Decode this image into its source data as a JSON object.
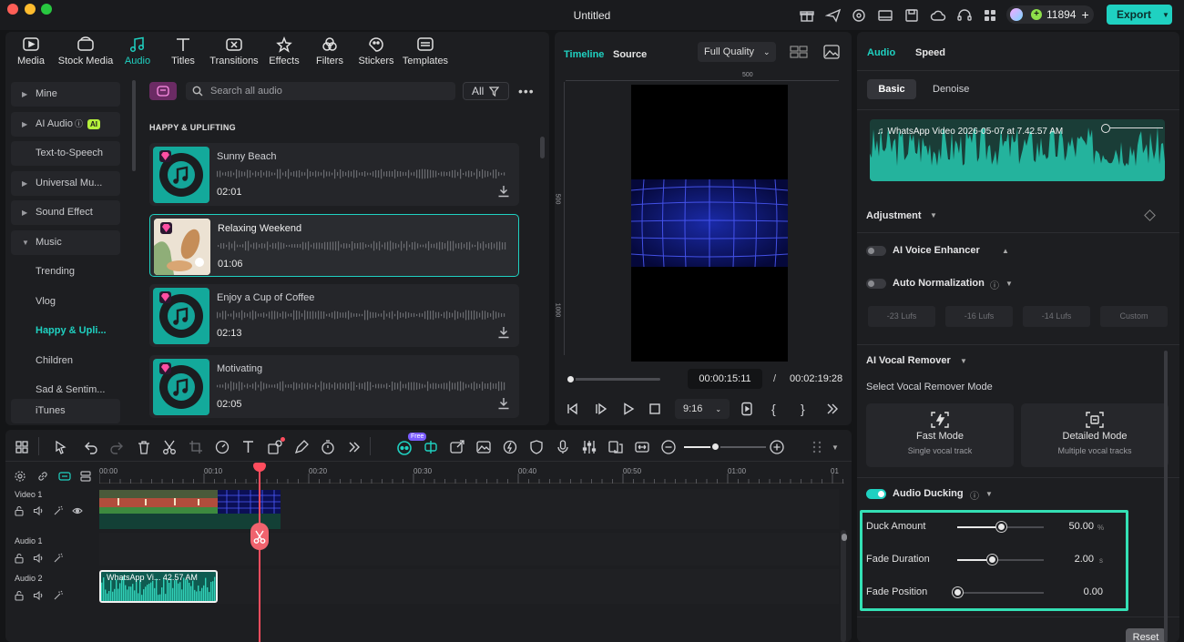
{
  "window": {
    "title": "Untitled",
    "credits": "11894",
    "export_label": "Export"
  },
  "media_tabs": [
    {
      "label": "Media",
      "icon": "media-icon"
    },
    {
      "label": "Stock Media",
      "icon": "stock-media-icon"
    },
    {
      "label": "Audio",
      "icon": "music-note-icon",
      "active": true
    },
    {
      "label": "Titles",
      "icon": "titles-icon"
    },
    {
      "label": "Transitions",
      "icon": "transitions-icon"
    },
    {
      "label": "Effects",
      "icon": "effects-icon"
    },
    {
      "label": "Filters",
      "icon": "filters-icon"
    },
    {
      "label": "Stickers",
      "icon": "stickers-icon"
    },
    {
      "label": "Templates",
      "icon": "templates-icon"
    }
  ],
  "sidebar": {
    "items": [
      {
        "label": "Mine"
      },
      {
        "label": "AI Audio",
        "badge": "AI"
      },
      {
        "label": "Text-to-Speech"
      },
      {
        "label": "Universal Mu..."
      },
      {
        "label": "Sound Effect"
      },
      {
        "label": "Music"
      },
      {
        "label": "Trending"
      },
      {
        "label": "Vlog"
      },
      {
        "label": "Happy & Upli..."
      },
      {
        "label": "Children"
      },
      {
        "label": "Sad & Sentim..."
      },
      {
        "label": "iTunes"
      }
    ]
  },
  "library": {
    "search_placeholder": "Search all audio",
    "filter_label": "All",
    "section_title": "HAPPY & UPLIFTING",
    "tracks": [
      {
        "name": "Sunny Beach",
        "duration": "02:01"
      },
      {
        "name": "Relaxing Weekend",
        "duration": "01:06"
      },
      {
        "name": "Enjoy a Cup of Coffee",
        "duration": "02:13"
      },
      {
        "name": "Motivating",
        "duration": "02:05"
      }
    ]
  },
  "preview": {
    "tab_timeline": "Timeline",
    "tab_source": "Source",
    "quality": "Full Quality",
    "ruler_top": "500",
    "ruler_left_1": "500",
    "ruler_left_2": "1000",
    "current_time": "00:00:15:11",
    "separator": "/",
    "total_time": "00:02:19:28",
    "aspect": "9:16",
    "progress": 0.04
  },
  "props": {
    "tab_audio": "Audio",
    "tab_speed": "Speed",
    "sub_basic": "Basic",
    "sub_denoise": "Denoise",
    "clip_name": "WhatsApp Video 2026-05-07 at 7.42.57 AM",
    "adjustment": "Adjustment",
    "ai_voice_enhancer": "AI Voice Enhancer",
    "auto_normalization": "Auto Normalization",
    "lufs": [
      "-23 Lufs",
      "-16 Lufs",
      "-14 Lufs",
      "Custom"
    ],
    "ai_vocal_remover": "AI Vocal Remover",
    "vocal_mode_label": "Select Vocal Remover Mode",
    "fast_mode": {
      "title": "Fast Mode",
      "sub": "Single vocal track"
    },
    "detailed_mode": {
      "title": "Detailed Mode",
      "sub": "Multiple vocal tracks"
    },
    "audio_ducking": "Audio Ducking",
    "duck_amount": {
      "label": "Duck Amount",
      "value": "50.00",
      "unit": "%",
      "fraction": 0.5
    },
    "fade_duration": {
      "label": "Fade Duration",
      "value": "2.00",
      "unit": "s",
      "fraction": 0.4
    },
    "fade_position": {
      "label": "Fade Position",
      "value": "0.00",
      "fraction": 0.0
    },
    "reset": "Reset"
  },
  "timeline": {
    "ruler": [
      "00:00",
      "00:10",
      "00:20",
      "00:30",
      "00:40",
      "00:50",
      "01:00",
      "01"
    ],
    "tracks": [
      "Video 1",
      "Audio 1",
      "Audio 2"
    ],
    "audio_clip_label": "WhatsApp Vi... 42.57 AM",
    "free_badge": "Free"
  },
  "colors": {
    "accent": "#1fd1c1",
    "playhead": "#ff4d5e",
    "export": "#1fd1c1"
  }
}
